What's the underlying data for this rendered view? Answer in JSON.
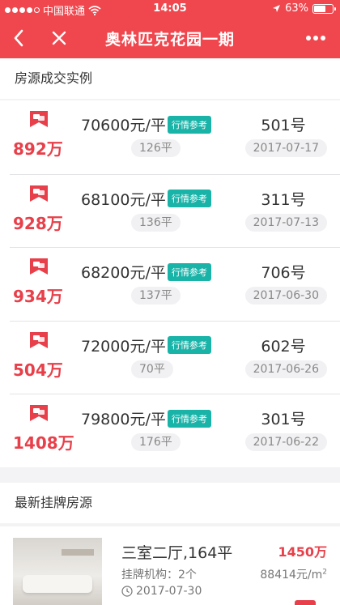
{
  "status_bar": {
    "carrier": "中国联通",
    "time": "14:05",
    "battery_text": "63%",
    "battery_level": 0.63
  },
  "nav": {
    "title": "奥林匹克花园一期"
  },
  "deals_section": {
    "title": "房源成交实例",
    "ref_label": "行情参考",
    "items": [
      {
        "total": "892万",
        "unit_price": "70600元/平",
        "area": "126平",
        "room": "501号",
        "date": "2017-07-17"
      },
      {
        "total": "928万",
        "unit_price": "68100元/平",
        "area": "136平",
        "room": "311号",
        "date": "2017-07-13"
      },
      {
        "total": "934万",
        "unit_price": "68200元/平",
        "area": "137平",
        "room": "706号",
        "date": "2017-06-30"
      },
      {
        "total": "504万",
        "unit_price": "72000元/平",
        "area": "70平",
        "room": "602号",
        "date": "2017-06-26"
      },
      {
        "total": "1408万",
        "unit_price": "79800元/平",
        "area": "176平",
        "room": "301号",
        "date": "2017-06-22"
      }
    ]
  },
  "listings_section": {
    "title": "最新挂牌房源",
    "items": [
      {
        "name": "三室二厅,164平",
        "agency": "挂牌机构：2个",
        "date": "2017-07-30",
        "price": "1450万",
        "unit_price": "88414元/m",
        "unit_sup": "2"
      }
    ]
  },
  "colors": {
    "brand_red": "#f0474e",
    "price_red": "#e8404a",
    "teal_badge": "#1ab3a8"
  }
}
